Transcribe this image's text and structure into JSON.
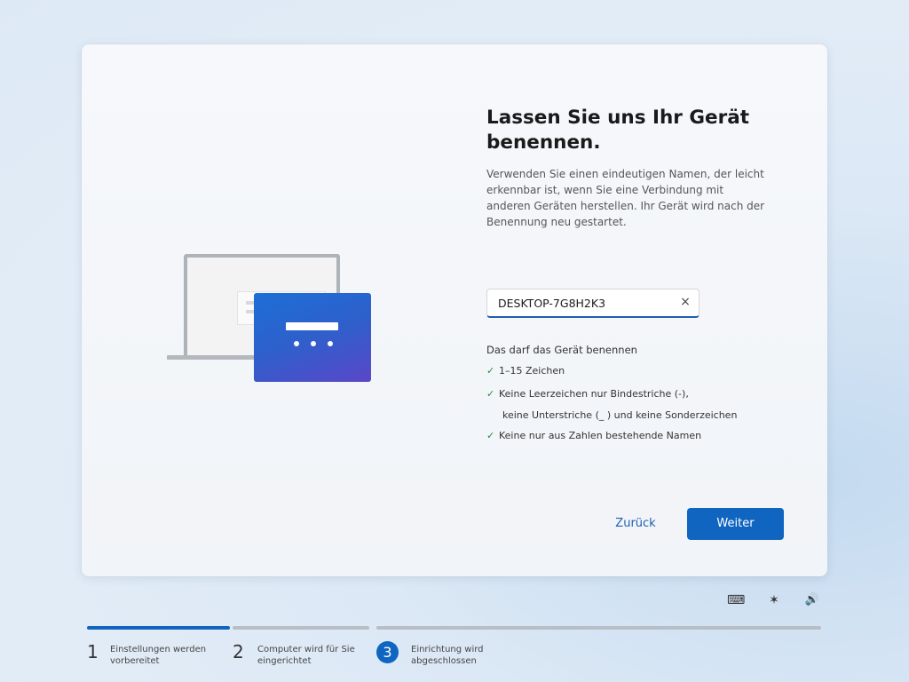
{
  "page": {
    "title_line1": "Lassen Sie uns Ihr Gerät",
    "title_line2": "benennen.",
    "description": "Verwenden Sie einen eindeutigen Namen, der leicht erkennbar ist, wenn Sie eine Verbindung mit anderen Geräten herstellen. Ihr Gerät wird nach der Benennung neu gestartet."
  },
  "input": {
    "value": "DESKTOP-7G8H2K3",
    "clear_icon": "×"
  },
  "rules": {
    "heading": "Das darf das Gerät benennen",
    "check_icon": "✓",
    "items": [
      {
        "line1": "1–15 Zeichen",
        "line2": ""
      },
      {
        "line1": "Keine Leerzeichen nur Bindestriche (-),",
        "line2": "keine Unterstriche (_ ) und keine Sonderzeichen"
      },
      {
        "line1": "Keine nur aus Zahlen bestehende Namen",
        "line2": ""
      }
    ]
  },
  "buttons": {
    "back": "Zurück",
    "next": "Weiter"
  },
  "system_icons": {
    "keyboard": "⌨",
    "accessibility": "✶",
    "volume": "🔊"
  },
  "steps": [
    {
      "number": "1",
      "line1": "Einstellungen werden",
      "line2": "vorbereitet",
      "state": "done"
    },
    {
      "number": "2",
      "line1": "Computer wird für Sie",
      "line2": "eingerichtet",
      "state": "pending"
    },
    {
      "number": "3",
      "line1": "Einrichtung wird",
      "line2": "abgeschlossen",
      "state": "current"
    }
  ],
  "colors": {
    "accent": "#1065c0",
    "progress_done": "#1065c0",
    "progress_pending": "#b8bec6",
    "check": "#2a8a3a"
  }
}
